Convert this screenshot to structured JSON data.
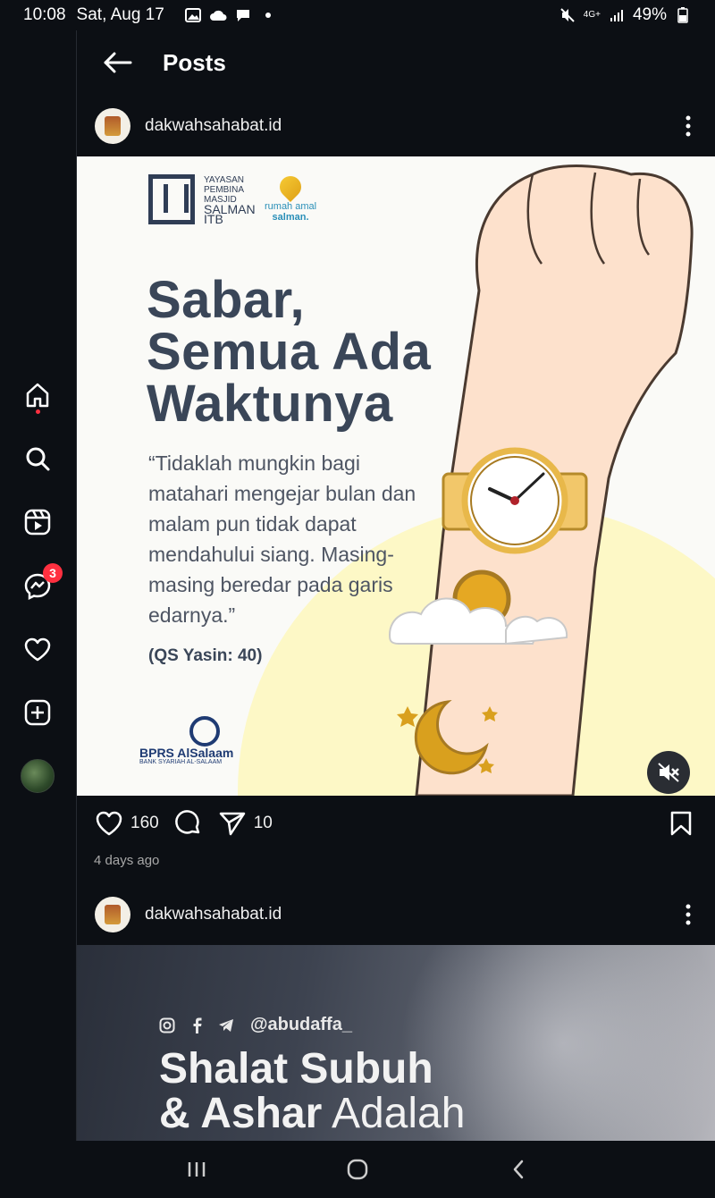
{
  "status_bar": {
    "time": "10:08",
    "date": "Sat, Aug 17",
    "network": "4G+",
    "battery": "49%"
  },
  "sidebar": {
    "items": [
      {
        "name": "home",
        "icon": "home-icon"
      },
      {
        "name": "search",
        "icon": "search-icon"
      },
      {
        "name": "reels",
        "icon": "reels-icon"
      },
      {
        "name": "messages",
        "icon": "messenger-icon",
        "badge": "3"
      },
      {
        "name": "notifications",
        "icon": "heart-icon"
      },
      {
        "name": "create",
        "icon": "plus-square-icon"
      },
      {
        "name": "profile",
        "icon": "profile-avatar"
      }
    ]
  },
  "header": {
    "title": "Posts"
  },
  "posts": [
    {
      "username": "dakwahsahabat.id",
      "image": {
        "logo_line1": "YAYASAN",
        "logo_line2": "PEMBINA",
        "logo_line3": "MASJID",
        "logo_line4": "SALMAN",
        "logo_line5": "ITB",
        "rumah_line1": "rumah amal",
        "rumah_line2": "salman.",
        "headline_1": "Sabar,",
        "headline_2": "Semua Ada",
        "headline_3": "Waktunya",
        "quote": "“Tidaklah mungkin bagi matahari mengejar bulan dan malam pun tidak dapat mendahului siang. Masing-masing beredar pada garis edarnya.”",
        "citation": "(QS Yasin: 40)",
        "bank_name": "BPRS AlSalaam",
        "bank_sub": "BANK SYARIAH AL-SALAAM"
      },
      "likes": "160",
      "shares": "10",
      "timestamp": "4 days ago"
    },
    {
      "username": "dakwahsahabat.id",
      "image": {
        "handle": "@abudaffa_",
        "headline_1": "Shalat Subuh",
        "headline_2a": "& Ashar",
        "headline_2b": " Adalah"
      }
    }
  ],
  "colors": {
    "background": "#0c0f14",
    "badge": "#ff3040",
    "headline": "#3a4658"
  }
}
